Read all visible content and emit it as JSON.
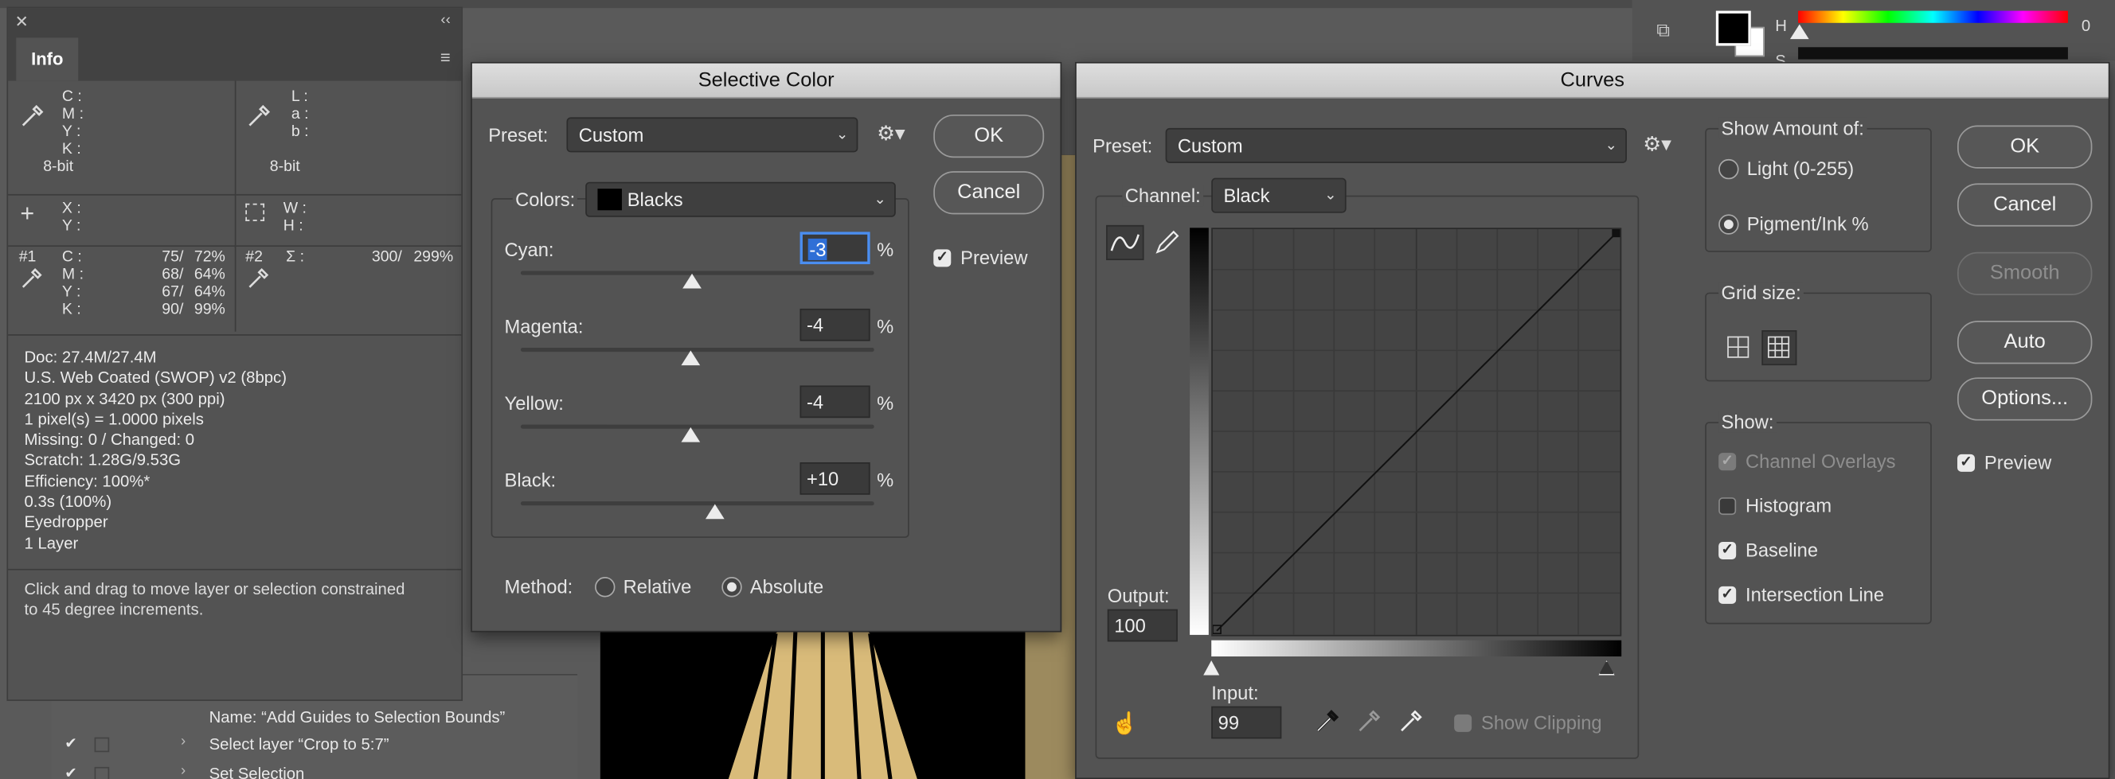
{
  "info_panel": {
    "tab": "Info",
    "cmyk_labels": [
      "C :",
      "M :",
      "Y :",
      "K :"
    ],
    "lab_labels": [
      "L :",
      "a :",
      "b :"
    ],
    "bitdepth_left": "8-bit",
    "bitdepth_right": "8-bit",
    "xy_labels": [
      "X :",
      "Y :"
    ],
    "wh_labels": [
      "W :",
      "H :"
    ],
    "sample1": {
      "id": "#1",
      "rows": [
        [
          "C :",
          "75/",
          "72%"
        ],
        [
          "M :",
          "68/",
          "64%"
        ],
        [
          "Y :",
          "67/",
          "64%"
        ],
        [
          "K :",
          "90/",
          "99%"
        ]
      ]
    },
    "sample2": {
      "id": "#2",
      "sigma": "Σ :",
      "value1": "300/",
      "value2": "299%"
    },
    "doc_info": [
      "Doc: 27.4M/27.4M",
      "U.S. Web Coated (SWOP) v2 (8bpc)",
      "2100 px x 3420 px (300 ppi)",
      "1 pixel(s) = 1.0000 pixels",
      "Missing: 0 / Changed: 0",
      "Scratch: 1.28G/9.53G",
      "Efficiency: 100%*",
      "0.3s (100%)",
      "Eyedropper",
      "1 Layer"
    ],
    "hint": [
      "Click and drag to move layer or selection constrained",
      "to 45 degree increments."
    ]
  },
  "actions": [
    "Name:  “Add Guides to Selection Bounds”",
    "Select layer “Crop to 5:7”",
    "Set Selection"
  ],
  "color_picker": {
    "h_label": "H",
    "s_label": "S",
    "h_value": "0"
  },
  "selective_color": {
    "title": "Selective Color",
    "preset_label": "Preset:",
    "preset_value": "Custom",
    "colors_label": "Colors:",
    "colors_value": "Blacks",
    "sliders": [
      {
        "label": "Cyan:",
        "value": "-3",
        "unit": "%",
        "fraction": 0.485
      },
      {
        "label": "Magenta:",
        "value": "-4",
        "unit": "%",
        "fraction": 0.48
      },
      {
        "label": "Yellow:",
        "value": "-4",
        "unit": "%",
        "fraction": 0.48
      },
      {
        "label": "Black:",
        "value": "+10",
        "unit": "%",
        "fraction": 0.55
      }
    ],
    "method_label": "Method:",
    "method_options": [
      "Relative",
      "Absolute"
    ],
    "method_selected": "Absolute",
    "ok": "OK",
    "cancel": "Cancel",
    "preview": "Preview",
    "preview_checked": true
  },
  "curves": {
    "title": "Curves",
    "preset_label": "Preset:",
    "preset_value": "Custom",
    "channel_label": "Channel:",
    "channel_value": "Black",
    "output_label": "Output:",
    "output_value": "100",
    "input_label": "Input:",
    "input_value": "99",
    "show_clipping": "Show Clipping",
    "show_amount_title": "Show Amount of:",
    "light_option": "Light  (0-255)",
    "pigment_option": "Pigment/Ink %",
    "grid_title": "Grid size:",
    "show_title": "Show:",
    "show_options": [
      {
        "label": "Channel Overlays",
        "state": "disabled"
      },
      {
        "label": "Histogram",
        "state": "off"
      },
      {
        "label": "Baseline",
        "state": "on"
      },
      {
        "label": "Intersection Line",
        "state": "on"
      }
    ],
    "buttons": {
      "ok": "OK",
      "cancel": "Cancel",
      "smooth": "Smooth",
      "auto": "Auto",
      "options": "Options..."
    },
    "preview": "Preview"
  }
}
